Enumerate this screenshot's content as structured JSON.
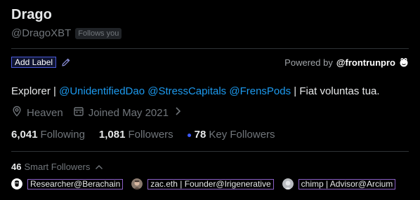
{
  "profile": {
    "name": "Drago",
    "handle": "@DragoXBT",
    "follows_you": "Follows you"
  },
  "label_bar": {
    "add_label": "Add Label",
    "powered_prefix": "Powered by",
    "powered_brand": "@frontrunpro"
  },
  "bio": {
    "prefix": "Explorer | ",
    "mention1": "@UnidentifiedDao",
    "mention2": "@StressCapitals",
    "mention3": "@FrensPods",
    "suffix": " | Fiat voluntas tua."
  },
  "meta": {
    "location": "Heaven",
    "joined": "Joined May 2021"
  },
  "stats": {
    "following_count": "6,041",
    "following_label": "Following",
    "followers_count": "1,081",
    "followers_label": "Followers",
    "key_followers_count": "78",
    "key_followers_label": "Key Followers"
  },
  "smart_followers": {
    "count": "46",
    "label": "Smart Followers",
    "items": [
      {
        "label": "Researcher@Berachain"
      },
      {
        "label": "zac.eth | Founder@Irigenerative"
      },
      {
        "label": "chimp | Advisor@Arcium"
      }
    ]
  },
  "colors": {
    "background": "#000000",
    "mention": "#1d9bf0",
    "muted": "#71767b",
    "tag_border": "#8a5fc4",
    "add_label_border": "#4a5bdc",
    "key_dot": "#3d5afe"
  }
}
